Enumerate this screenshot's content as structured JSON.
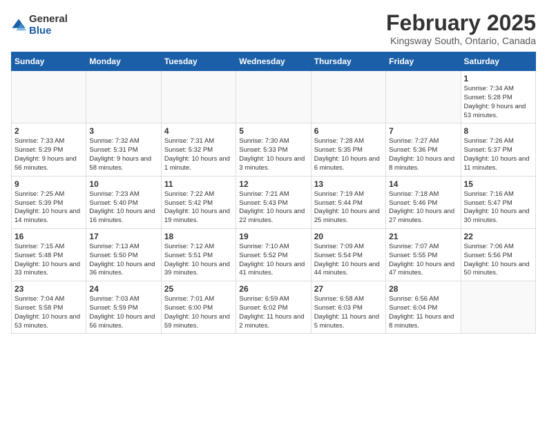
{
  "logo": {
    "general": "General",
    "blue": "Blue"
  },
  "header": {
    "month": "February 2025",
    "location": "Kingsway South, Ontario, Canada"
  },
  "days_of_week": [
    "Sunday",
    "Monday",
    "Tuesday",
    "Wednesday",
    "Thursday",
    "Friday",
    "Saturday"
  ],
  "weeks": [
    [
      {
        "day": "",
        "info": ""
      },
      {
        "day": "",
        "info": ""
      },
      {
        "day": "",
        "info": ""
      },
      {
        "day": "",
        "info": ""
      },
      {
        "day": "",
        "info": ""
      },
      {
        "day": "",
        "info": ""
      },
      {
        "day": "1",
        "info": "Sunrise: 7:34 AM\nSunset: 5:28 PM\nDaylight: 9 hours and 53 minutes."
      }
    ],
    [
      {
        "day": "2",
        "info": "Sunrise: 7:33 AM\nSunset: 5:29 PM\nDaylight: 9 hours and 56 minutes."
      },
      {
        "day": "3",
        "info": "Sunrise: 7:32 AM\nSunset: 5:31 PM\nDaylight: 9 hours and 58 minutes."
      },
      {
        "day": "4",
        "info": "Sunrise: 7:31 AM\nSunset: 5:32 PM\nDaylight: 10 hours and 1 minute."
      },
      {
        "day": "5",
        "info": "Sunrise: 7:30 AM\nSunset: 5:33 PM\nDaylight: 10 hours and 3 minutes."
      },
      {
        "day": "6",
        "info": "Sunrise: 7:28 AM\nSunset: 5:35 PM\nDaylight: 10 hours and 6 minutes."
      },
      {
        "day": "7",
        "info": "Sunrise: 7:27 AM\nSunset: 5:36 PM\nDaylight: 10 hours and 8 minutes."
      },
      {
        "day": "8",
        "info": "Sunrise: 7:26 AM\nSunset: 5:37 PM\nDaylight: 10 hours and 11 minutes."
      }
    ],
    [
      {
        "day": "9",
        "info": "Sunrise: 7:25 AM\nSunset: 5:39 PM\nDaylight: 10 hours and 14 minutes."
      },
      {
        "day": "10",
        "info": "Sunrise: 7:23 AM\nSunset: 5:40 PM\nDaylight: 10 hours and 16 minutes."
      },
      {
        "day": "11",
        "info": "Sunrise: 7:22 AM\nSunset: 5:42 PM\nDaylight: 10 hours and 19 minutes."
      },
      {
        "day": "12",
        "info": "Sunrise: 7:21 AM\nSunset: 5:43 PM\nDaylight: 10 hours and 22 minutes."
      },
      {
        "day": "13",
        "info": "Sunrise: 7:19 AM\nSunset: 5:44 PM\nDaylight: 10 hours and 25 minutes."
      },
      {
        "day": "14",
        "info": "Sunrise: 7:18 AM\nSunset: 5:46 PM\nDaylight: 10 hours and 27 minutes."
      },
      {
        "day": "15",
        "info": "Sunrise: 7:16 AM\nSunset: 5:47 PM\nDaylight: 10 hours and 30 minutes."
      }
    ],
    [
      {
        "day": "16",
        "info": "Sunrise: 7:15 AM\nSunset: 5:48 PM\nDaylight: 10 hours and 33 minutes."
      },
      {
        "day": "17",
        "info": "Sunrise: 7:13 AM\nSunset: 5:50 PM\nDaylight: 10 hours and 36 minutes."
      },
      {
        "day": "18",
        "info": "Sunrise: 7:12 AM\nSunset: 5:51 PM\nDaylight: 10 hours and 39 minutes."
      },
      {
        "day": "19",
        "info": "Sunrise: 7:10 AM\nSunset: 5:52 PM\nDaylight: 10 hours and 41 minutes."
      },
      {
        "day": "20",
        "info": "Sunrise: 7:09 AM\nSunset: 5:54 PM\nDaylight: 10 hours and 44 minutes."
      },
      {
        "day": "21",
        "info": "Sunrise: 7:07 AM\nSunset: 5:55 PM\nDaylight: 10 hours and 47 minutes."
      },
      {
        "day": "22",
        "info": "Sunrise: 7:06 AM\nSunset: 5:56 PM\nDaylight: 10 hours and 50 minutes."
      }
    ],
    [
      {
        "day": "23",
        "info": "Sunrise: 7:04 AM\nSunset: 5:58 PM\nDaylight: 10 hours and 53 minutes."
      },
      {
        "day": "24",
        "info": "Sunrise: 7:03 AM\nSunset: 5:59 PM\nDaylight: 10 hours and 56 minutes."
      },
      {
        "day": "25",
        "info": "Sunrise: 7:01 AM\nSunset: 6:00 PM\nDaylight: 10 hours and 59 minutes."
      },
      {
        "day": "26",
        "info": "Sunrise: 6:59 AM\nSunset: 6:02 PM\nDaylight: 11 hours and 2 minutes."
      },
      {
        "day": "27",
        "info": "Sunrise: 6:58 AM\nSunset: 6:03 PM\nDaylight: 11 hours and 5 minutes."
      },
      {
        "day": "28",
        "info": "Sunrise: 6:56 AM\nSunset: 6:04 PM\nDaylight: 11 hours and 8 minutes."
      },
      {
        "day": "",
        "info": ""
      }
    ]
  ]
}
